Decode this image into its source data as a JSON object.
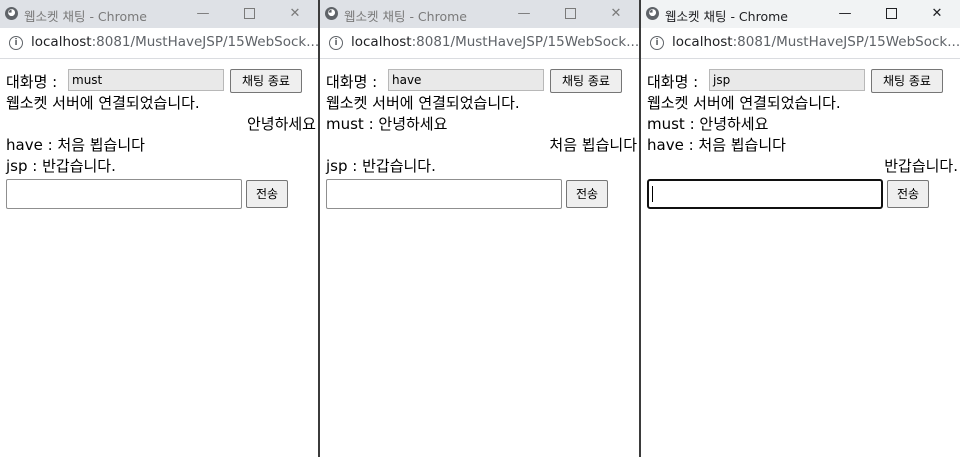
{
  "window_title": "웹소켓 채팅 - Chrome",
  "url": {
    "host": "localhost",
    "rest": ":8081/MustHaveJSP/15WebSock..."
  },
  "chat": {
    "nickname_label": "대화명 :",
    "end_button": "채팅 종료",
    "connected_message": "웹소켓 서버에 연결되었습니다.",
    "send_button": "전송"
  },
  "windows": [
    {
      "nickname": "must",
      "messages": [
        {
          "text": "안녕하세요",
          "align": "right"
        },
        {
          "text": "have : 처음 뵙습니다",
          "align": "left"
        },
        {
          "text": "jsp : 반갑습니다.",
          "align": "left"
        }
      ]
    },
    {
      "nickname": "have",
      "messages": [
        {
          "text": "must : 안녕하세요",
          "align": "left"
        },
        {
          "text": "처음 뵙습니다",
          "align": "right"
        },
        {
          "text": "jsp : 반갑습니다.",
          "align": "left"
        }
      ]
    },
    {
      "nickname": "jsp",
      "messages": [
        {
          "text": "must : 안녕하세요",
          "align": "left"
        },
        {
          "text": "have : 처음 뵙습니다",
          "align": "left"
        },
        {
          "text": "반갑습니다.",
          "align": "right"
        }
      ]
    }
  ]
}
